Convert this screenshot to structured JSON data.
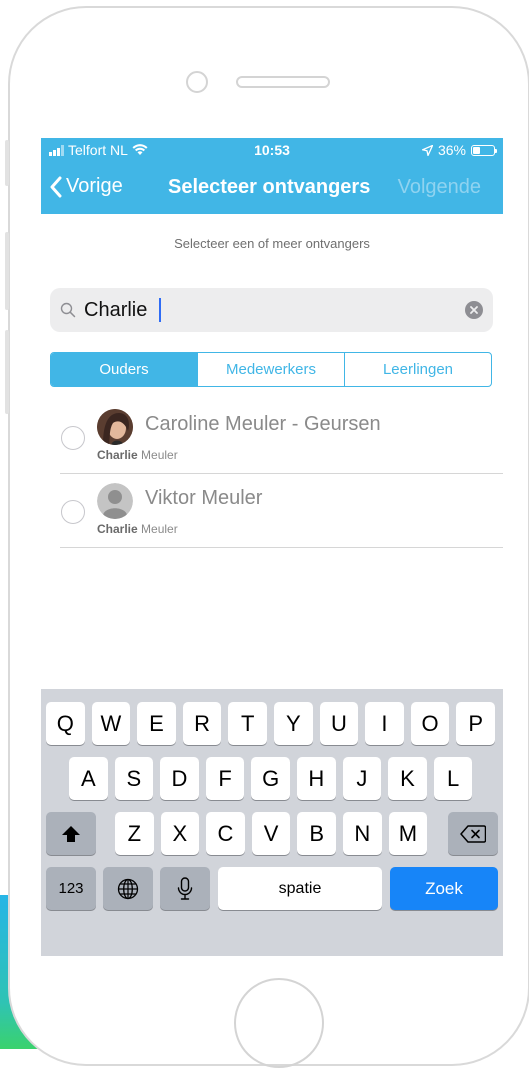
{
  "status_bar": {
    "carrier": "Telfort NL",
    "time": "10:53",
    "battery": "36%",
    "battery_level": 0.36
  },
  "nav": {
    "back_label": "Vorige",
    "title": "Selecteer ontvangers",
    "next_label": "Volgende"
  },
  "subtitle": "Selecteer een of meer ontvangers",
  "search": {
    "value": "Charlie"
  },
  "segments": [
    {
      "label": "Ouders",
      "active": true
    },
    {
      "label": "Medewerkers",
      "active": false
    },
    {
      "label": "Leerlingen",
      "active": false
    }
  ],
  "recipients": [
    {
      "name": "Caroline Meuler - Geursen",
      "match": "Charlie",
      "rest": "Meuler",
      "avatar": "photo-avatar"
    },
    {
      "name": "Viktor Meuler",
      "match": "Charlie",
      "rest": "Meuler",
      "avatar": "placeholder-avatar-icon"
    }
  ],
  "keyboard": {
    "row1": [
      "Q",
      "W",
      "E",
      "R",
      "T",
      "Y",
      "U",
      "I",
      "O",
      "P"
    ],
    "row2": [
      "A",
      "S",
      "D",
      "F",
      "G",
      "H",
      "J",
      "K",
      "L"
    ],
    "row3": [
      "Z",
      "X",
      "C",
      "V",
      "B",
      "N",
      "M"
    ],
    "numbers_label": "123",
    "space_label": "spatie",
    "return_label": "Zoek"
  },
  "colors": {
    "accent": "#41b6e6",
    "return_key": "#1785f8"
  }
}
